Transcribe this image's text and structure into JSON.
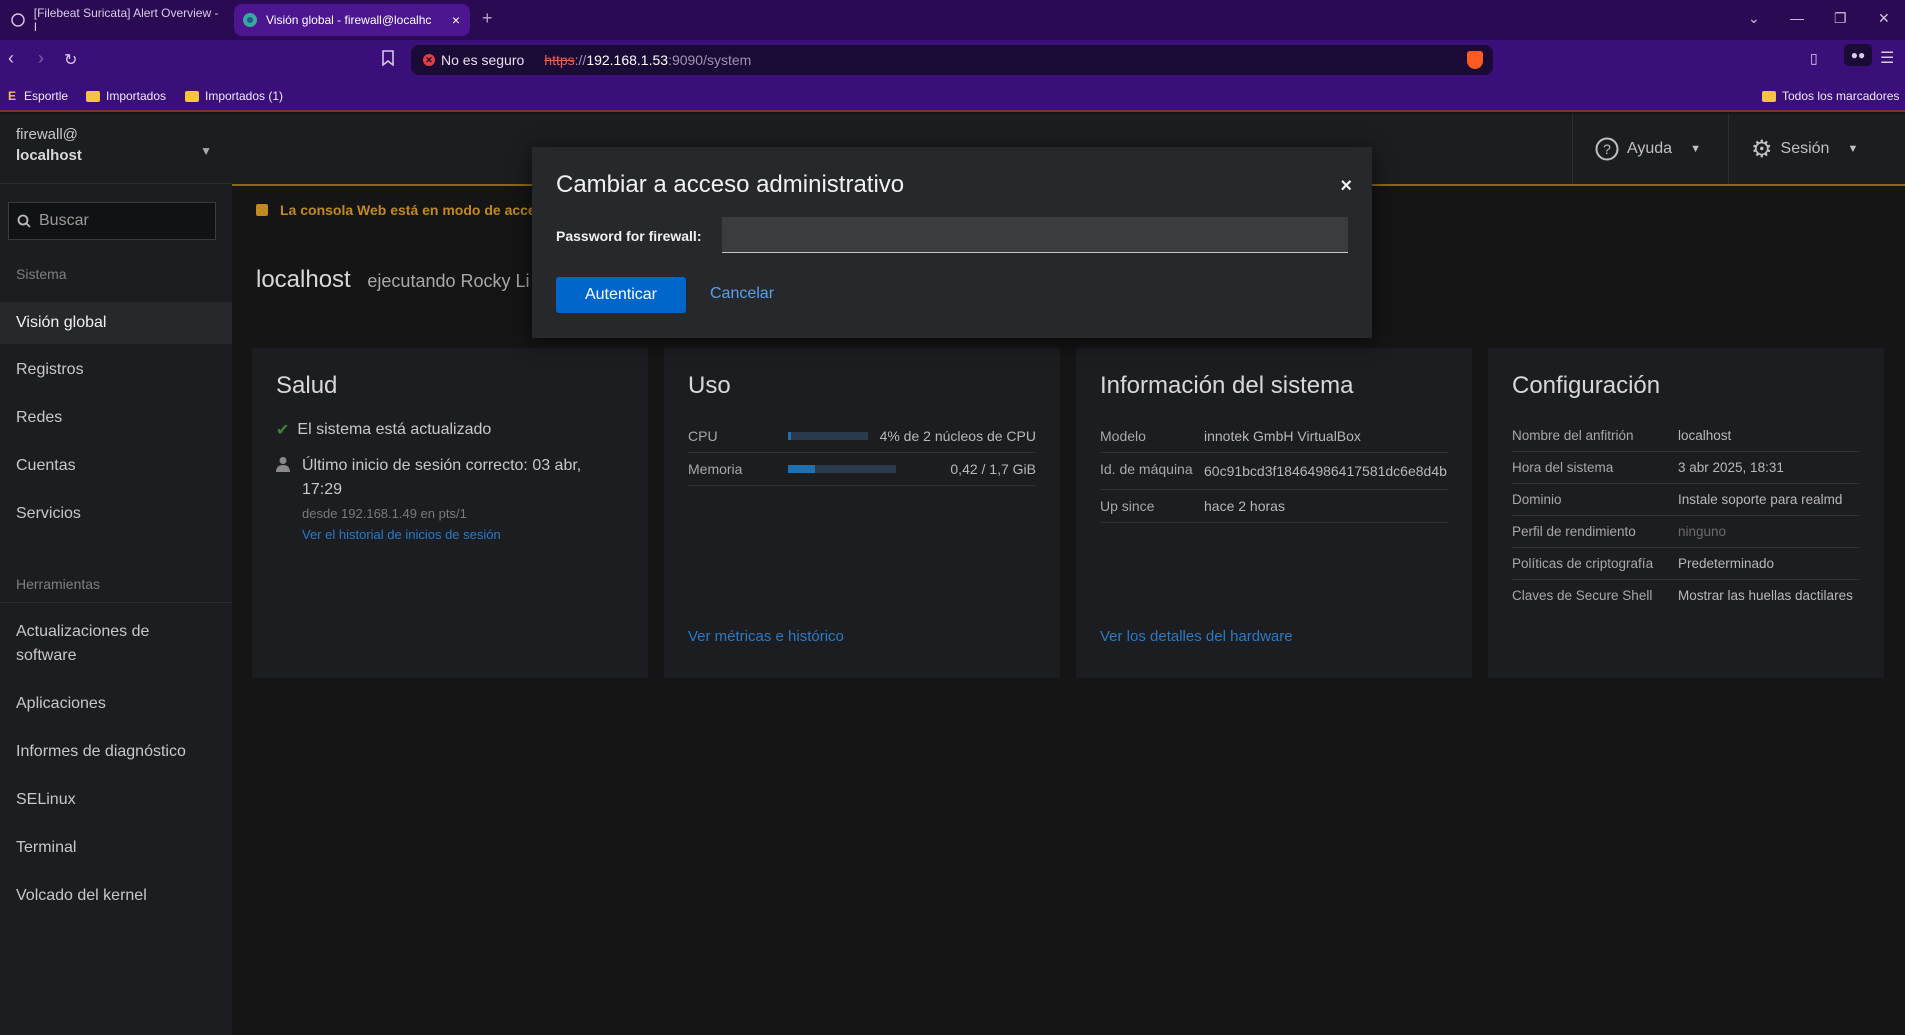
{
  "browser": {
    "tabs": [
      {
        "title": "[Filebeat Suricata] Alert Overview - I"
      },
      {
        "title": "Visión global - firewall@localhc"
      }
    ],
    "tab_close": "×",
    "new_tab": "+",
    "controls": {
      "dropdown": "⌄",
      "minimize": "—",
      "restore": "❐",
      "close": "✕"
    },
    "security_label": "No es seguro",
    "url": {
      "scheme": "https",
      "sep": "://",
      "host": "192.168.1.53",
      "rest": ":9090/system"
    },
    "bookmarks": [
      {
        "label": "Esportle"
      },
      {
        "label": "Importados"
      },
      {
        "label": "Importados (1)"
      }
    ],
    "all_bookmarks": "Todos los marcadores"
  },
  "sidebar": {
    "host_user": "firewall@",
    "host_name": "localhost",
    "search_placeholder": "Buscar",
    "section_system": "Sistema",
    "items_system": [
      "Visión global",
      "Registros",
      "Redes",
      "Cuentas",
      "Servicios"
    ],
    "section_tools": "Herramientas",
    "items_tools": [
      "Actualizaciones de software",
      "Aplicaciones",
      "Informes de diagnóstico",
      "SELinux",
      "Terminal",
      "Volcado del kernel"
    ]
  },
  "topbar": {
    "help": "Ayuda",
    "session": "Sesión"
  },
  "main": {
    "alert": "La consola Web está en modo de acces",
    "host": "localhost",
    "running": "ejecutando Rocky Li"
  },
  "cards": {
    "health": {
      "title": "Salud",
      "updated": "El sistema está actualizado",
      "last_login": "Último inicio de sesión correcto: 03 abr, 17:29",
      "from": "desde 192.168.1.49 en pts/1",
      "history_link": "Ver el historial de inicios de sesión"
    },
    "usage": {
      "title": "Uso",
      "cpu_label": "CPU",
      "cpu_value": "4% de 2 núcleos de CPU",
      "cpu_fraction": 0.04,
      "mem_label": "Memoria",
      "mem_value": "0,42 / 1,7 GiB",
      "mem_fraction": 0.25,
      "link": "Ver métricas e histórico"
    },
    "sysinfo": {
      "title": "Información del sistema",
      "model_k": "Modelo",
      "model_v": "innotek GmbH VirtualBox",
      "machine_k": "Id. de máquina",
      "machine_v": "60c91bcd3f18464986417581dc6e8d4b",
      "up_k": "Up since",
      "up_v": "hace 2 horas",
      "link": "Ver los detalles del hardware"
    },
    "config": {
      "title": "Configuración",
      "rows": [
        {
          "k": "Nombre del anfitrión",
          "v": "localhost"
        },
        {
          "k": "Hora del sistema",
          "v": "3 abr 2025, 18:31"
        },
        {
          "k": "Dominio",
          "v": "Instale soporte para realmd"
        },
        {
          "k": "Perfil de rendimiento",
          "v": "ninguno"
        },
        {
          "k": "Políticas de criptografía",
          "v": "Predeterminado"
        },
        {
          "k": "Claves de Secure Shell",
          "v": "Mostrar las huellas dactilares"
        }
      ]
    }
  },
  "modal": {
    "title": "Cambiar a acceso administrativo",
    "close": "×",
    "password_label": "Password for firewall:",
    "password_value": "",
    "auth_button": "Autenticar",
    "cancel_button": "Cancelar"
  },
  "colors": {
    "accent": "#0066cc",
    "link": "#2a7ac8",
    "warning": "#c08a20",
    "browser_bar": "#3a0f7a"
  }
}
